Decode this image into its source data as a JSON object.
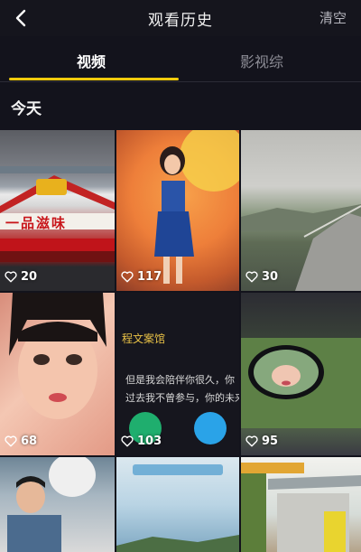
{
  "header": {
    "title": "观看历史",
    "clear_label": "清空"
  },
  "tabs": [
    {
      "label": "视频"
    },
    {
      "label": "影视综"
    }
  ],
  "section_title": "今天",
  "thumbnails": [
    {
      "likes": "20",
      "sign_text": "一品滋味",
      "icon": "heart-outline-icon"
    },
    {
      "likes": "117",
      "icon": "heart-outline-icon"
    },
    {
      "likes": "30",
      "icon": "heart-outline-icon"
    },
    {
      "likes": "68",
      "icon": "heart-outline-icon"
    },
    {
      "likes": "103",
      "caption_line1": "程文案馆",
      "caption_line2": "但是我会陪伴你很久，你",
      "caption_line3": "过去我不曾参与，你的未来",
      "icon": "heart-outline-icon"
    },
    {
      "likes": "95",
      "icon": "heart-outline-icon"
    },
    {},
    {},
    {}
  ],
  "colors": {
    "background": "#13131c",
    "accent": "#f0cb0c"
  }
}
